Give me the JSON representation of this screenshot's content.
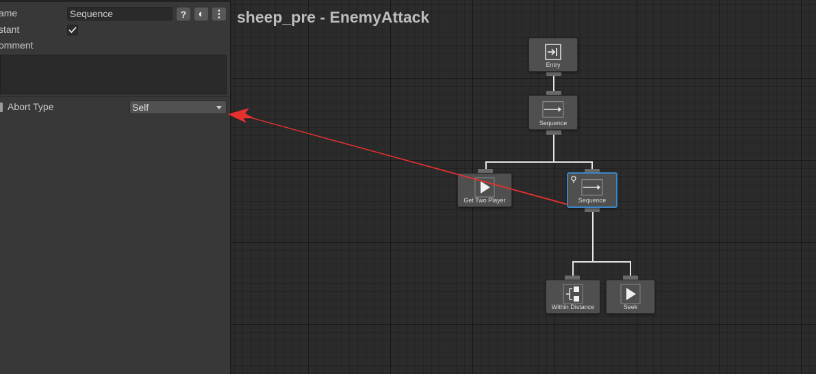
{
  "inspector": {
    "name_label": "ame",
    "name_value": "Sequence",
    "instant_label": "stant",
    "instant_checked": true,
    "comment_label": "omment",
    "comment_value": "",
    "abort_type_label": "Abort Type",
    "abort_type_value": "Self",
    "buttons": {
      "help": "?",
      "theme": "◐",
      "menu": "⋮"
    }
  },
  "graph": {
    "title": "sheep_pre - EnemyAttack",
    "nodes": {
      "entry": "Entry",
      "root_sequence": "Sequence",
      "get_two_player": "Get Two Player",
      "child_sequence": "Sequence",
      "within_distance": "Within Distance",
      "seek": "Seek"
    },
    "icons": {
      "entry": "entry-icon",
      "sequence": "sequence-arrow-icon",
      "action": "play-icon",
      "conditional": "conditional-icon",
      "abort": "conditional-abort-icon"
    }
  },
  "colors": {
    "panel": "#383838",
    "graph_bg": "#2b2b2b",
    "selection": "#3a86c8",
    "annotation_arrow": "#e8302e"
  }
}
